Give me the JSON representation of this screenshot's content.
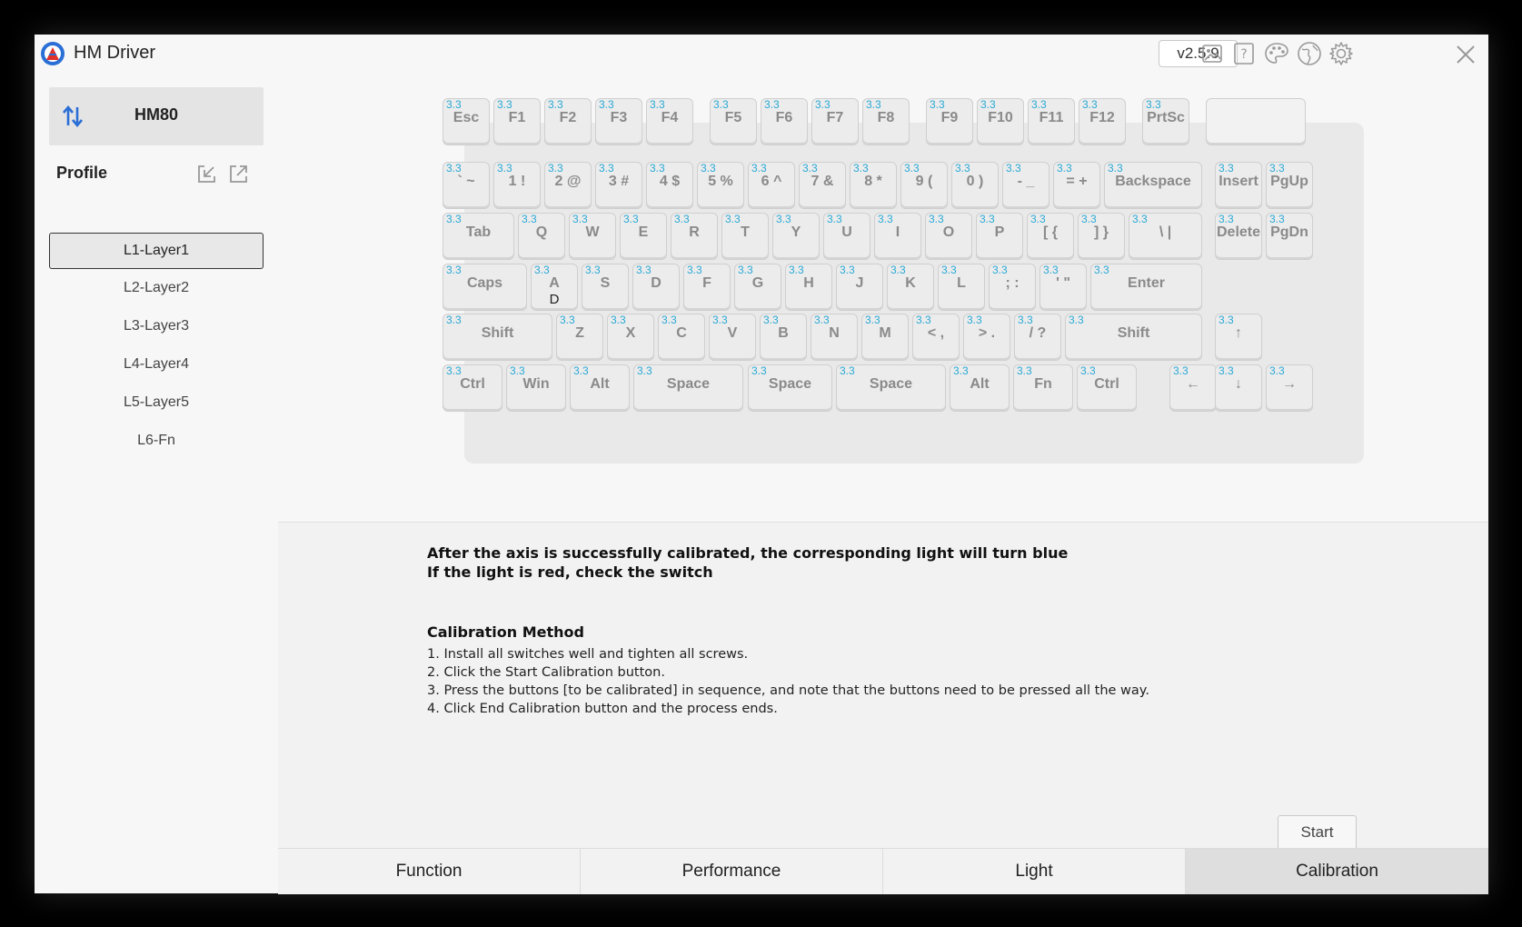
{
  "app": {
    "title": "HM Driver",
    "version": "v2.5.9"
  },
  "titlebar_icons": [
    "image-icon",
    "help-icon",
    "palette-icon",
    "globe-icon",
    "gear-icon",
    "close-icon"
  ],
  "sidebar": {
    "device": "HM80",
    "profile_label": "Profile",
    "layers": [
      "L1-Layer1",
      "L2-Layer2",
      "L3-Layer3",
      "L4-Layer4",
      "L5-Layer5",
      "L6-Fn"
    ],
    "active_layer": "L1-Layer1"
  },
  "keyboard": {
    "actuation_value": "3.3",
    "rows": [
      [
        "Esc",
        "F1",
        "F2",
        "F3",
        "F4",
        "F5",
        "F6",
        "F7",
        "F8",
        "F9",
        "F10",
        "F11",
        "F12",
        "PrtSc",
        ""
      ],
      [
        "` ~",
        "1 !",
        "2 @",
        "3 #",
        "4 $",
        "5 %",
        "6 ^",
        "7 &",
        "8 *",
        "9 (",
        "0 )",
        "- _",
        "= +",
        "Backspace",
        "Insert",
        "PgUp"
      ],
      [
        "Tab",
        "Q",
        "W",
        "E",
        "R",
        "T",
        "Y",
        "U",
        "I",
        "O",
        "P",
        "[ {",
        "] }",
        "\\ |",
        "Delete",
        "PgDn"
      ],
      [
        "Caps",
        "A",
        "S",
        "D",
        "F",
        "G",
        "H",
        "J",
        "K",
        "L",
        "; :",
        "' \"",
        "Enter"
      ],
      [
        "Shift",
        "Z",
        "X",
        "C",
        "V",
        "B",
        "N",
        "M",
        "< ,",
        "> .",
        "/ ?",
        "Shift",
        "↑"
      ],
      [
        "Ctrl",
        "Win",
        "Alt",
        "Space",
        "Space",
        "Space",
        "Alt",
        "Fn",
        "Ctrl",
        "←",
        "↓",
        "→"
      ]
    ],
    "a_key_sublabel": "D"
  },
  "instructions": {
    "line1": "After the axis is successfully calibrated, the corresponding light will turn blue",
    "line2": "If the light is red, check the switch",
    "method_title": "Calibration Method",
    "steps": [
      "1. Install all switches well and tighten all screws.",
      "2. Click the Start Calibration button.",
      "3. Press the buttons [to be calibrated] in sequence, and note that the buttons need to be pressed all the way.",
      "4. Click End Calibration button and the process ends."
    ]
  },
  "start_label": "Start",
  "tabs": [
    "Function",
    "Performance",
    "Light",
    "Calibration"
  ],
  "active_tab": "Calibration",
  "colors": {
    "value_text": "#29a9d6",
    "logo_red": "#e0312b",
    "logo_blue": "#2a6fd6",
    "swap_blue": "#2a6fd6"
  }
}
